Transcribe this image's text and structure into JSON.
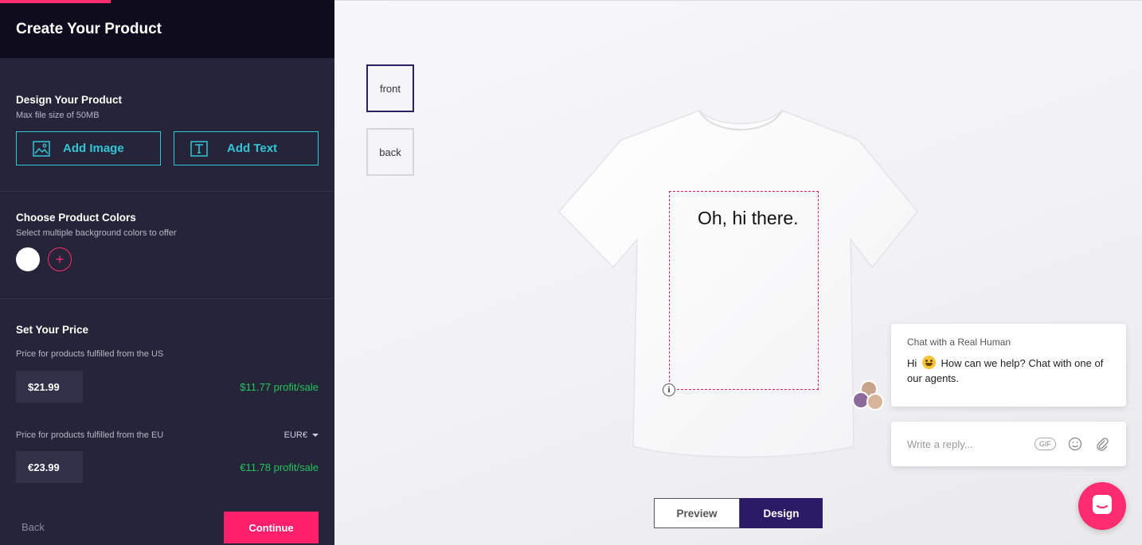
{
  "sidebar": {
    "title": "Create Your Product",
    "design": {
      "heading": "Design Your Product",
      "subtext": "Max file size of 50MB",
      "add_image_label": "Add Image",
      "add_text_label": "Add Text"
    },
    "colors": {
      "heading": "Choose Product Colors",
      "subtext": "Select multiple background colors to offer",
      "swatches": [
        "#ffffff"
      ]
    },
    "price": {
      "heading": "Set Your Price",
      "us_label": "Price for products fulfilled from the US",
      "us_price": "$21.99",
      "us_profit": "$11.77 profit/sale",
      "eu_label": "Price for products fulfilled from the EU",
      "eu_currency": "EUR€",
      "eu_price": "€23.99",
      "eu_profit": "€11.78 profit/sale"
    },
    "footer": {
      "back_label": "Back",
      "continue_label": "Continue"
    }
  },
  "canvas": {
    "views": [
      "front",
      "back"
    ],
    "selected_view": "front",
    "design_text": "Oh, hi there.",
    "toggle": {
      "preview_label": "Preview",
      "design_label": "Design",
      "active": "Design"
    }
  },
  "chat": {
    "title": "Chat with a Real Human",
    "message_before_emoji": "Hi",
    "message_after_emoji": "How can we help? Chat with one of our agents.",
    "input_placeholder": "Write a reply...",
    "gif_label": "GIF"
  },
  "colors": {
    "accent": "#ff2d6f",
    "teal": "#2fc6d8",
    "sidebar_bg": "#262438",
    "profit_green": "#22c55e",
    "design_active": "#2b1a66"
  },
  "icons": {
    "add_image": "image-icon",
    "add_text": "text-icon",
    "add_color": "plus-icon",
    "emoji": "smile-icon",
    "attach": "paperclip-icon",
    "launcher": "chat-icon"
  }
}
